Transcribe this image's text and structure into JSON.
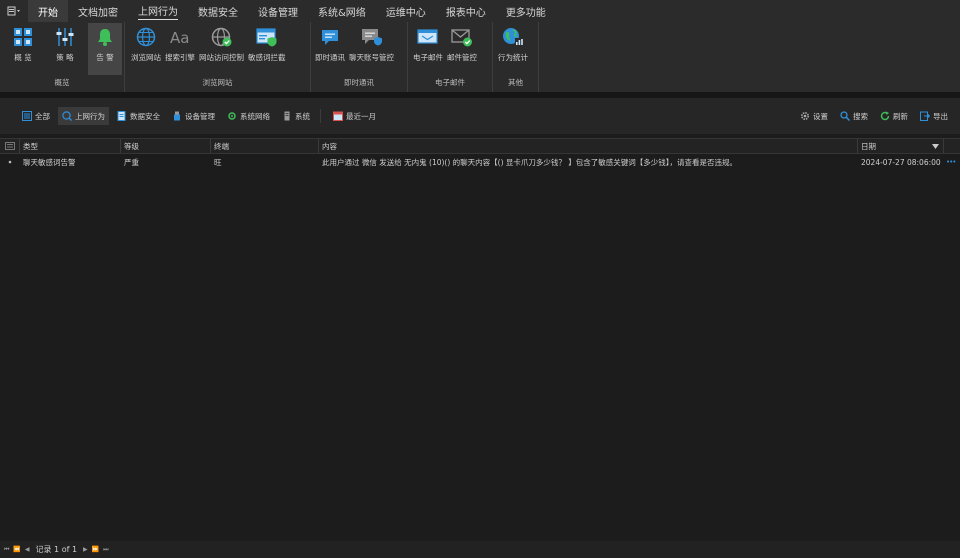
{
  "menubar": {
    "tabs": [
      {
        "label": "开始"
      },
      {
        "label": "文档加密"
      },
      {
        "label": "上网行为"
      },
      {
        "label": "数据安全"
      },
      {
        "label": "设备管理"
      },
      {
        "label": "系统&网络"
      },
      {
        "label": "运维中心"
      },
      {
        "label": "报表中心"
      },
      {
        "label": "更多功能"
      }
    ]
  },
  "ribbon": {
    "groups": [
      {
        "label": "概览",
        "items": [
          {
            "label": "概 览"
          },
          {
            "label": "策 略"
          },
          {
            "label": "告 警"
          }
        ]
      },
      {
        "label": "浏览网站",
        "items": [
          {
            "label": "浏览网站"
          },
          {
            "label": "搜索引擎"
          },
          {
            "label": "网站访问控制"
          },
          {
            "label": "敏感词拦截"
          }
        ]
      },
      {
        "label": "即时通讯",
        "items": [
          {
            "label": "即时通讯"
          },
          {
            "label": "聊天账号管控"
          }
        ]
      },
      {
        "label": "电子邮件",
        "items": [
          {
            "label": "电子邮件"
          },
          {
            "label": "邮件管控"
          }
        ]
      },
      {
        "label": "其他",
        "items": [
          {
            "label": "行为统计"
          }
        ]
      }
    ]
  },
  "toolbar": {
    "filters": [
      {
        "label": "全部"
      },
      {
        "label": "上网行为"
      },
      {
        "label": "数据安全"
      },
      {
        "label": "设备管理"
      },
      {
        "label": "系统网络"
      },
      {
        "label": "系统"
      }
    ],
    "time_range": "最近一月",
    "settings": "设置",
    "search": "搜索",
    "refresh": "刷新",
    "export": "导出"
  },
  "grid": {
    "columns": [
      "类型",
      "等级",
      "终端",
      "内容",
      "日期"
    ],
    "rows": [
      {
        "type": "聊天敏感词告警",
        "level": "严重",
        "terminal": "旺",
        "content": "此用户通过 微信 发送给 无内鬼 (10)() 的聊天内容【() 显卡爪刀多少钱？ 】包含了敏感关键词【多少钱】，请查看是否违规。",
        "date": "2024-07-27 08:06:00",
        "more": "•••"
      }
    ]
  },
  "pager": {
    "record_text": "记录 1 of 1"
  },
  "colors": {
    "accent": "#2f8fd8",
    "bell": "#3fbf5a",
    "background": "#1c1c1c"
  }
}
